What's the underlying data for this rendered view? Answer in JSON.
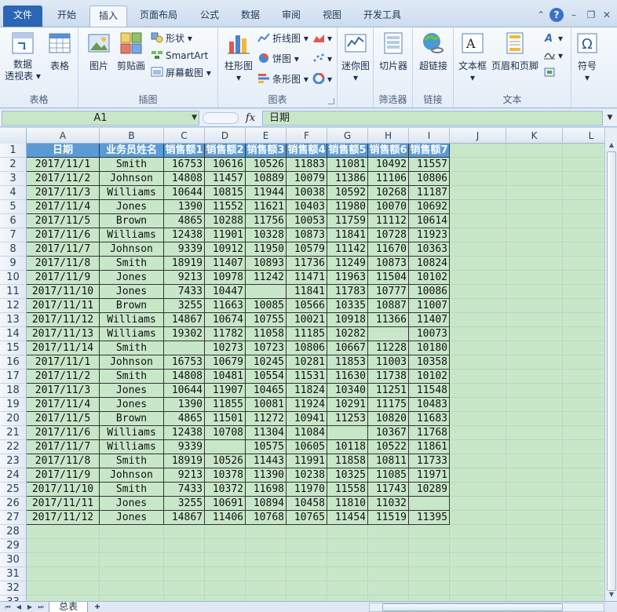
{
  "ribbon_tabs": [
    "文件",
    "开始",
    "插入",
    "页面布局",
    "公式",
    "数据",
    "审阅",
    "视图",
    "开发工具"
  ],
  "ribbon_groups": {
    "tables": {
      "label": "表格",
      "pivot": "数据\n透视表",
      "table": "表格"
    },
    "illustrations": {
      "label": "插图",
      "picture": "图片",
      "clipart": "剪贴画",
      "shapes": "形状",
      "smartart": "SmartArt",
      "screenshot": "屏幕截图"
    },
    "charts": {
      "label": "图表",
      "column": "柱形图",
      "line": "折线图",
      "pie": "饼图",
      "bar": "条形图"
    },
    "sparklines": {
      "label": "",
      "sparkline": "迷你图"
    },
    "filter": {
      "label": "筛选器",
      "slicer": "切片器"
    },
    "links": {
      "label": "链接",
      "hyperlink": "超链接"
    },
    "text": {
      "label": "文本",
      "textbox": "文本框",
      "header_footer": "页眉和页脚"
    },
    "symbols": {
      "label": "",
      "symbol": "符号"
    }
  },
  "formula_bar": {
    "name_box": "A1",
    "fx": "fx",
    "content": "日期"
  },
  "columns": [
    "A",
    "B",
    "C",
    "D",
    "E",
    "F",
    "G",
    "H",
    "I",
    "J",
    "K",
    "L"
  ],
  "header_row": [
    "日期",
    "业务员姓名",
    "销售额1",
    "销售额2",
    "销售额3",
    "销售额4",
    "销售额5",
    "销售额6",
    "销售额7"
  ],
  "rows": [
    [
      "2017/11/1",
      "Smith",
      "16753",
      "10616",
      "10526",
      "11883",
      "11081",
      "10492",
      "11557"
    ],
    [
      "2017/11/2",
      "Johnson",
      "14808",
      "11457",
      "10889",
      "10079",
      "11386",
      "11106",
      "10806"
    ],
    [
      "2017/11/3",
      "Williams",
      "10644",
      "10815",
      "11944",
      "10038",
      "10592",
      "10268",
      "11187"
    ],
    [
      "2017/11/4",
      "Jones",
      "1390",
      "11552",
      "11621",
      "10403",
      "11980",
      "10070",
      "10692"
    ],
    [
      "2017/11/5",
      "Brown",
      "4865",
      "10288",
      "11756",
      "10053",
      "11759",
      "11112",
      "10614"
    ],
    [
      "2017/11/6",
      "Williams",
      "12438",
      "11901",
      "10328",
      "10873",
      "11841",
      "10728",
      "11923"
    ],
    [
      "2017/11/7",
      "Johnson",
      "9339",
      "10912",
      "11950",
      "10579",
      "11142",
      "11670",
      "10363"
    ],
    [
      "2017/11/8",
      "Smith",
      "18919",
      "11407",
      "10893",
      "11736",
      "11249",
      "10873",
      "10824"
    ],
    [
      "2017/11/9",
      "Jones",
      "9213",
      "10978",
      "11242",
      "11471",
      "11963",
      "11504",
      "10102"
    ],
    [
      "2017/11/10",
      "Jones",
      "7433",
      "10447",
      "",
      "11841",
      "11783",
      "10777",
      "10086"
    ],
    [
      "2017/11/11",
      "Brown",
      "3255",
      "11663",
      "10085",
      "10566",
      "10335",
      "10887",
      "11007"
    ],
    [
      "2017/11/12",
      "Williams",
      "14867",
      "10674",
      "10755",
      "10021",
      "10918",
      "11366",
      "11407"
    ],
    [
      "2017/11/13",
      "Williams",
      "19302",
      "11782",
      "11058",
      "11185",
      "10282",
      "",
      "10073"
    ],
    [
      "2017/11/14",
      "Smith",
      "",
      "10273",
      "10723",
      "10806",
      "10667",
      "11228",
      "10180"
    ],
    [
      "2017/11/1",
      "Johnson",
      "16753",
      "10679",
      "10245",
      "10281",
      "11853",
      "11003",
      "10358"
    ],
    [
      "2017/11/2",
      "Smith",
      "14808",
      "10481",
      "10554",
      "11531",
      "11630",
      "11738",
      "10102"
    ],
    [
      "2017/11/3",
      "Jones",
      "10644",
      "11907",
      "10465",
      "11824",
      "10340",
      "11251",
      "11548"
    ],
    [
      "2017/11/4",
      "Jones",
      "1390",
      "11855",
      "10081",
      "11924",
      "10291",
      "11175",
      "10483"
    ],
    [
      "2017/11/5",
      "Brown",
      "4865",
      "11501",
      "11272",
      "10941",
      "11253",
      "10820",
      "11683"
    ],
    [
      "2017/11/6",
      "Williams",
      "12438",
      "10708",
      "11304",
      "11084",
      "",
      "10367",
      "11768"
    ],
    [
      "2017/11/7",
      "Williams",
      "9339",
      "",
      "10575",
      "10605",
      "10118",
      "10522",
      "11861"
    ],
    [
      "2017/11/8",
      "Smith",
      "18919",
      "10526",
      "11443",
      "11991",
      "11858",
      "10811",
      "11733"
    ],
    [
      "2017/11/9",
      "Johnson",
      "9213",
      "10378",
      "11390",
      "10238",
      "10325",
      "11085",
      "11971"
    ],
    [
      "2017/11/10",
      "Smith",
      "7433",
      "10372",
      "11698",
      "11970",
      "11558",
      "11743",
      "10289"
    ],
    [
      "2017/11/11",
      "Jones",
      "3255",
      "10691",
      "10894",
      "10458",
      "11810",
      "11032",
      ""
    ],
    [
      "2017/11/12",
      "Jones",
      "14867",
      "11406",
      "10768",
      "10765",
      "11454",
      "11519",
      "11395"
    ]
  ],
  "row_numbers": [
    "1",
    "2",
    "3",
    "4",
    "5",
    "6",
    "7",
    "8",
    "9",
    "10",
    "11",
    "12",
    "13",
    "14",
    "15",
    "16",
    "17",
    "18",
    "19",
    "20",
    "21",
    "22",
    "23",
    "24",
    "25",
    "26",
    "27",
    "28",
    "29",
    "30",
    "31",
    "32",
    "33"
  ],
  "sheet_tab": "总表",
  "colors": {
    "header_fill": "#5b9bd5",
    "cell_fill": "#c8e7c9",
    "file_tab": "#2a66b5"
  }
}
